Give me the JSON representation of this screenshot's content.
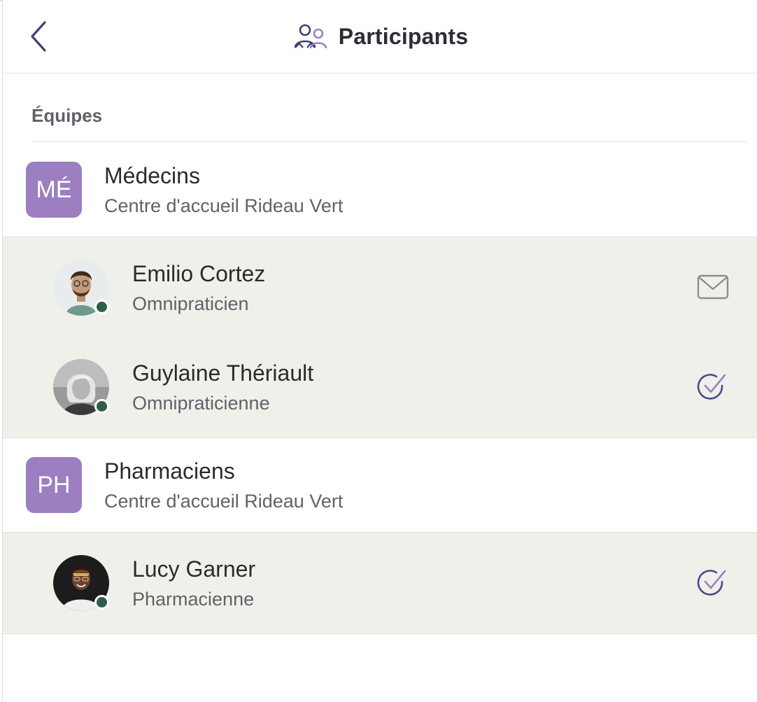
{
  "header": {
    "title": "Participants",
    "back_icon": "chevron-left-icon",
    "title_icon": "participants-icon"
  },
  "section": {
    "title": "Équipes"
  },
  "teams": [
    {
      "initials": "MÉ",
      "name": "Médecins",
      "subtitle": "Centre d'accueil Rideau Vert",
      "members": [
        {
          "name": "Emilio Cortez",
          "role": "Omnipraticien",
          "status": "online",
          "action_icon": "mail-icon"
        },
        {
          "name": "Guylaine Thériault",
          "role": "Omnipraticienne",
          "status": "online",
          "action_icon": "check-circle-icon"
        }
      ]
    },
    {
      "initials": "PH",
      "name": "Pharmaciens",
      "subtitle": "Centre d'accueil Rideau Vert",
      "members": [
        {
          "name": "Lucy Garner",
          "role": "Pharmacienne",
          "status": "online",
          "action_icon": "check-circle-icon"
        }
      ]
    }
  ],
  "colors": {
    "team_badge": "#9b7fc0",
    "member_bg": "#f0f0eb",
    "online_dot": "#2e5e4e",
    "accent": "#4a4a8a"
  }
}
